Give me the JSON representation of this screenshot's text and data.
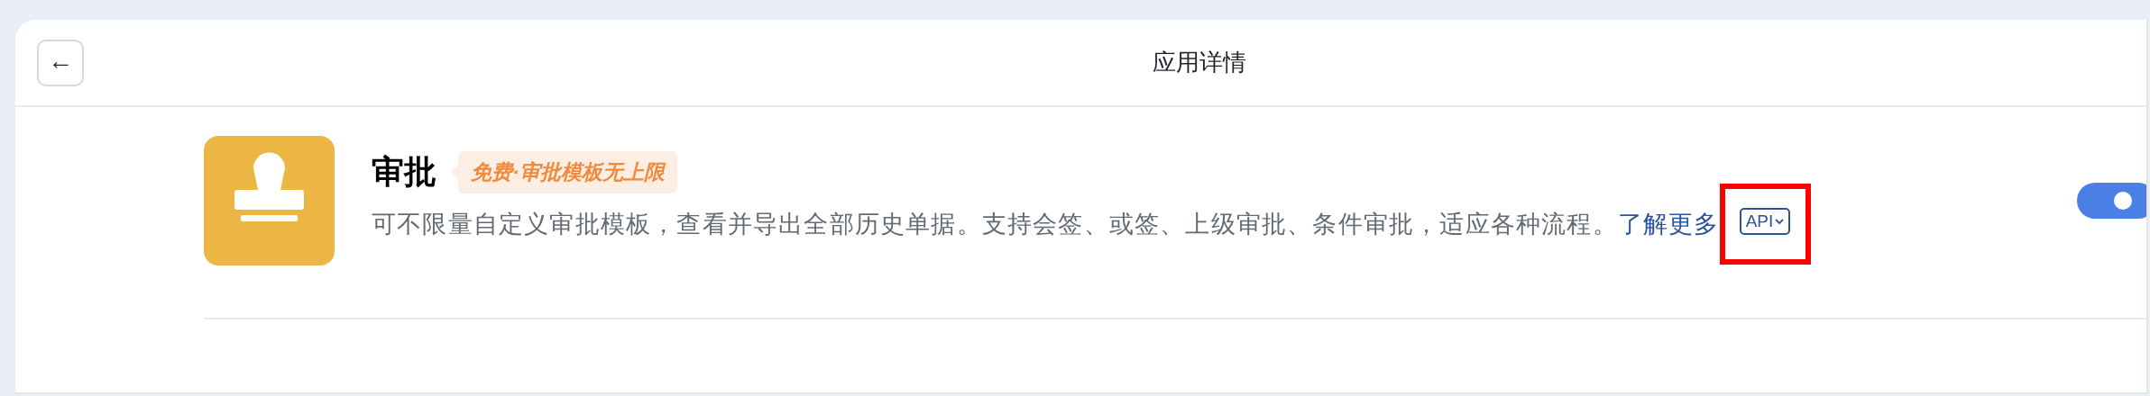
{
  "header": {
    "title": "应用详情",
    "back_button": "←"
  },
  "app": {
    "name": "审批",
    "badge": "免费·审批模板无上限",
    "description": "可不限量自定义审批模板，查看并导出全部历史单据。支持会签、或签、上级审批、条件审批，适应各种流程。",
    "link": "了解更多",
    "api_tag": "API",
    "enabled": true
  }
}
